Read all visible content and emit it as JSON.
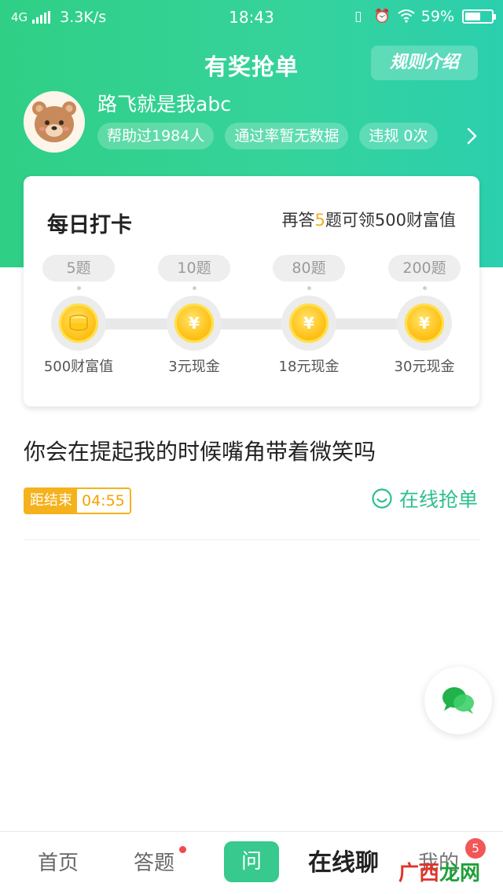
{
  "status_bar": {
    "network": "4G",
    "speed": "3.3K/s",
    "time": "18:43",
    "battery_text": "59%",
    "battery_level": 0.59
  },
  "header": {
    "title": "有奖抢单",
    "rules_button": "规则介绍"
  },
  "profile": {
    "username": "路飞就是我abc",
    "chips": [
      "帮助过1984人",
      "通过率暂无数据",
      "违规 0次"
    ]
  },
  "checkin": {
    "title": "每日打卡",
    "hint_prefix": "再答",
    "hint_count": "5",
    "hint_suffix": "题可领500财富值",
    "milestones": [
      {
        "target": "5题",
        "reward": "500财富值",
        "icon": "coin-stack-icon"
      },
      {
        "target": "10题",
        "reward": "3元现金",
        "icon": "yuan-coin-icon"
      },
      {
        "target": "80题",
        "reward": "18元现金",
        "icon": "yuan-coin-icon"
      },
      {
        "target": "200题",
        "reward": "30元现金",
        "icon": "yuan-coin-icon"
      }
    ]
  },
  "question": {
    "text": "你会在提起我的时候嘴角带着微笑吗",
    "countdown_label": "距结束",
    "countdown_value": "04:55",
    "grab_label": "在线抢单"
  },
  "tabbar": {
    "home": "首页",
    "answer": "答题",
    "ask": "问",
    "chat": "在线聊",
    "mine": "我的",
    "mine_badge": "5"
  },
  "watermark": {
    "part1": "广西",
    "part2": "龙网"
  },
  "colors": {
    "brand_green": "#35d39a",
    "accent_gold": "#f5b21d",
    "grab_green": "#2ebf8c",
    "badge_red": "#f25656"
  }
}
